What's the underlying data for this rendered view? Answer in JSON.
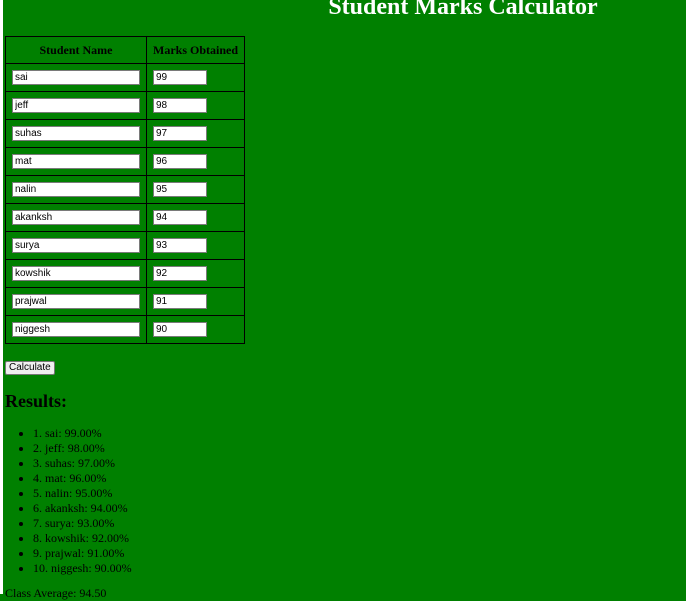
{
  "page": {
    "title": "Student Marks Calculator"
  },
  "table": {
    "headers": {
      "name": "Student Name",
      "marks": "Marks Obtained"
    },
    "rows": [
      {
        "name": "sai",
        "marks": "99"
      },
      {
        "name": "jeff",
        "marks": "98"
      },
      {
        "name": "suhas",
        "marks": "97"
      },
      {
        "name": "mat",
        "marks": "96"
      },
      {
        "name": "nalin",
        "marks": "95"
      },
      {
        "name": "akanksh",
        "marks": "94"
      },
      {
        "name": "surya",
        "marks": "93"
      },
      {
        "name": "kowshik",
        "marks": "92"
      },
      {
        "name": "prajwal",
        "marks": "91"
      },
      {
        "name": "niggesh",
        "marks": "90"
      }
    ]
  },
  "actions": {
    "calculate_label": "Calculate"
  },
  "results": {
    "heading": "Results:",
    "items": [
      "1. sai: 99.00%",
      "2. jeff: 98.00%",
      "3. suhas: 97.00%",
      "4. mat: 96.00%",
      "5. nalin: 95.00%",
      "6. akanksh: 94.00%",
      "7. surya: 93.00%",
      "8. kowshik: 92.00%",
      "9. prajwal: 91.00%",
      "10. niggesh: 90.00%"
    ],
    "class_average": "Class Average: 94.50"
  },
  "colors": {
    "background": "#008000",
    "title_text": "#ffffff"
  }
}
